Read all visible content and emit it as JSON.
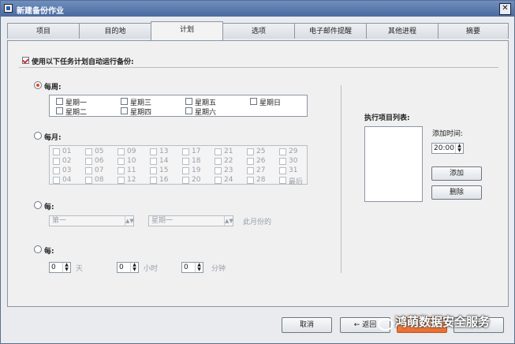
{
  "window": {
    "title": "新建备份作业",
    "close_glyph": "✕"
  },
  "tabs": [
    "项目",
    "目的地",
    "计划",
    "选项",
    "电子邮件提醒",
    "其他进程",
    "摘要"
  ],
  "active_tab": "计划",
  "schedule_enable": {
    "label": "使用以下任务计划自动运行备份:",
    "checked": true
  },
  "weekly": {
    "label": "每周:",
    "selected": true,
    "days": [
      "星期一",
      "星期三",
      "星期五",
      "星期日",
      "星期二",
      "星期四",
      "星期六"
    ]
  },
  "monthly": {
    "label": "每月:",
    "days": [
      "01",
      "05",
      "09",
      "13",
      "17",
      "21",
      "25",
      "29",
      "02",
      "06",
      "10",
      "14",
      "18",
      "22",
      "26",
      "30",
      "03",
      "07",
      "11",
      "15",
      "19",
      "23",
      "27",
      "31",
      "04",
      "08",
      "12",
      "16",
      "20",
      "24",
      "28",
      "最后"
    ]
  },
  "every_nth": {
    "label": "每:",
    "week_value": "第一",
    "weekday_value": "星期一",
    "suffix": "此月份的"
  },
  "interval": {
    "label": "每:",
    "days_value": "0",
    "days_unit": "天",
    "hours_value": "0",
    "hours_unit": "小时",
    "minutes_value": "0",
    "minutes_unit": "分钟"
  },
  "exec_list": {
    "label": "执行项目列表:",
    "add_time_label": "添加时间:",
    "time_value": "20:00",
    "add_button": "添加",
    "delete_button": "删除"
  },
  "footer": {
    "cancel": "取消",
    "back": "返回",
    "next": "下一步",
    "ok": "确定"
  },
  "watermark": "鸿萌数据安全服务"
}
